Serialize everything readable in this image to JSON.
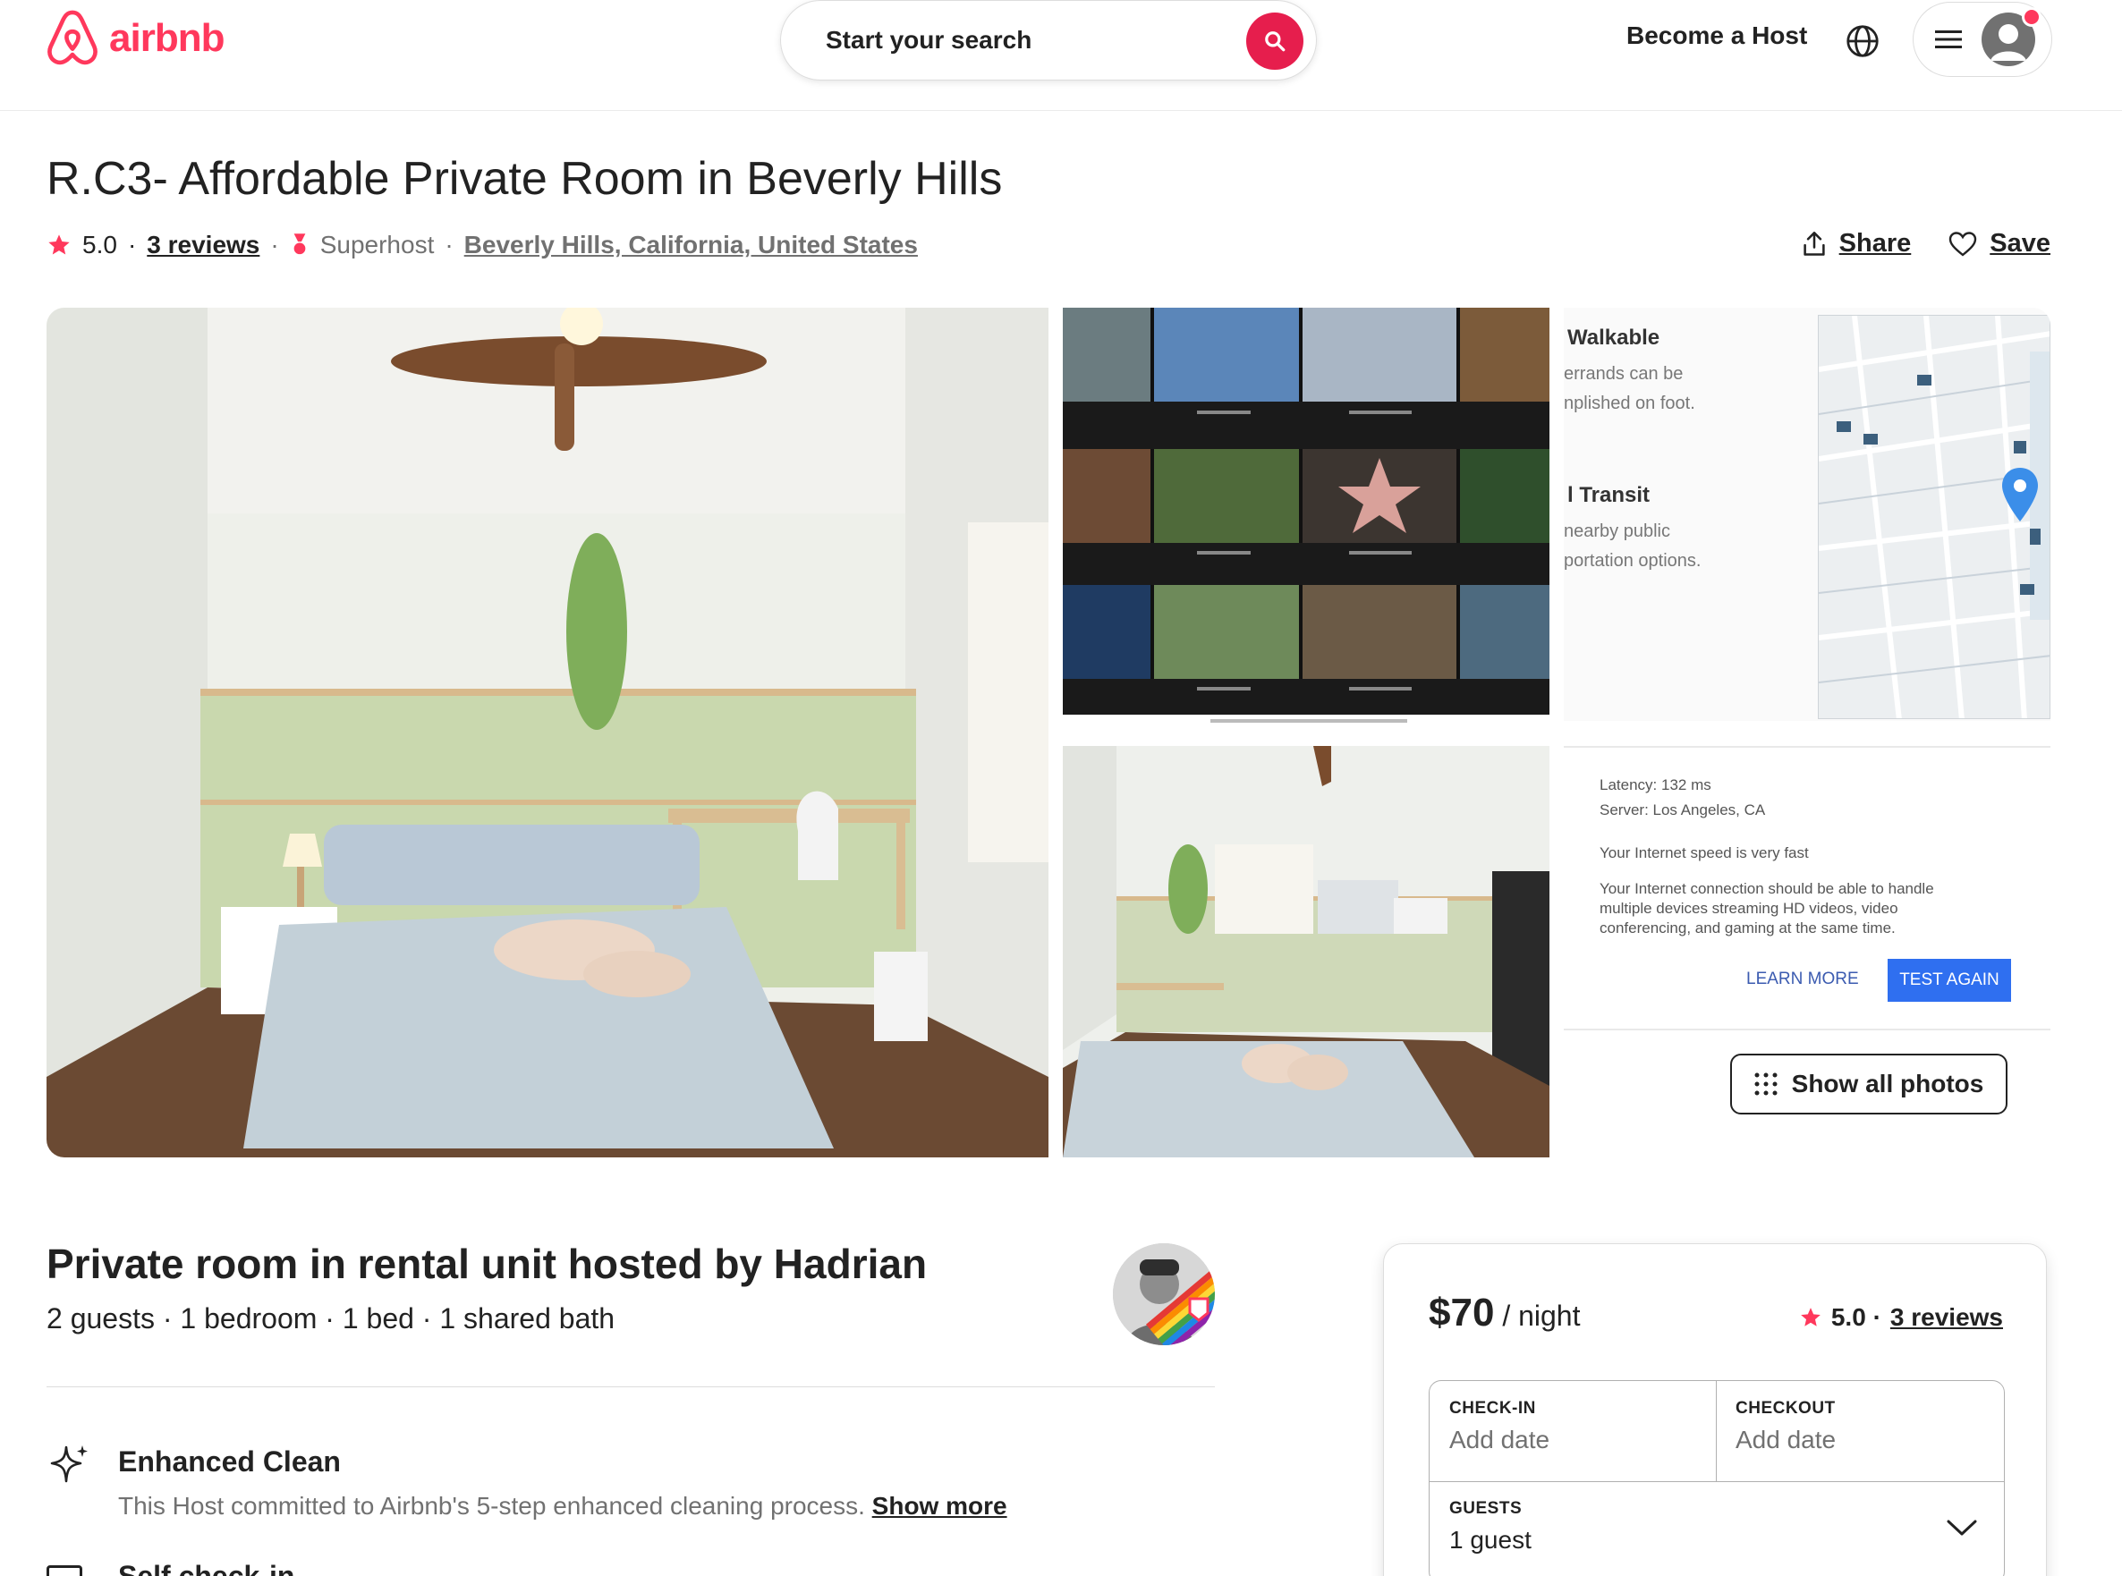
{
  "header": {
    "logo_text": "airbnb",
    "search_label": "Start your search",
    "become_host": "Become a Host",
    "brand_color": "#FF385C"
  },
  "listing": {
    "title": "R.C3- Affordable Private Room in Beverly Hills",
    "rating": "5.0",
    "reviews_link": "3 reviews",
    "host_badge": "Superhost",
    "location": "Beverly Hills, California, United States",
    "share_label": "Share",
    "save_label": "Save"
  },
  "gallery": {
    "walk_heading": "Walkable",
    "walk_line1": "errands can be",
    "walk_line2": "nplished on foot.",
    "transit_heading": "l Transit",
    "transit_line1": "nearby public",
    "transit_line2": "portation options.",
    "speed_latency": "Latency: 132 ms",
    "speed_server": "Server: Los Angeles, CA",
    "speed_result": "Your Internet speed is very fast",
    "speed_desc1": "Your Internet connection should be able to handle",
    "speed_desc2": "multiple devices streaming HD videos, video",
    "speed_desc3": "conferencing, and gaming at the same time.",
    "learn_more": "LEARN MORE",
    "test_again": "TEST AGAIN",
    "show_all": "Show all photos"
  },
  "details": {
    "host_title": "Private room in rental unit hosted by Hadrian",
    "host_sub": "2 guests · 1 bedroom · 1 bed · 1 shared bath",
    "feature_title": "Enhanced Clean",
    "feature_desc": "This Host committed to Airbnb's 5-step enhanced cleaning process.",
    "feature_more": "Show more",
    "feature2_title": "Self check-in"
  },
  "booking": {
    "price": "$70",
    "per_night": " / night",
    "rating": "5.0 ·",
    "reviews_link": "3 reviews",
    "checkin_label": "CHECK-IN",
    "checkin_value": "Add date",
    "checkout_label": "CHECKOUT",
    "checkout_value": "Add date",
    "guests_label": "GUESTS",
    "guests_value": "1 guest"
  }
}
